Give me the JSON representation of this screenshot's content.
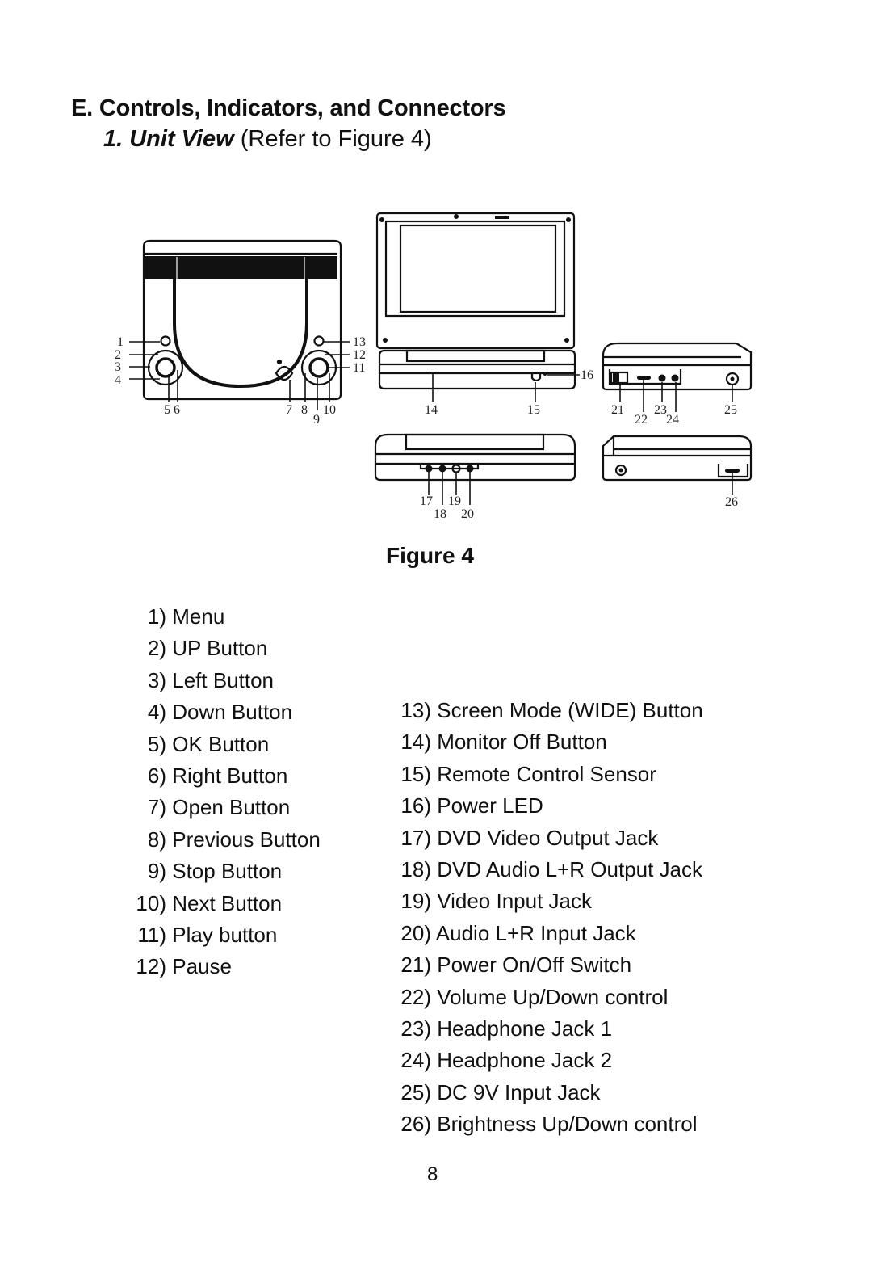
{
  "heading": "E. Controls, Indicators, and Connectors",
  "subheading": {
    "label": "1. Unit View",
    "ref": "(Refer to Figure 4)"
  },
  "figure": {
    "caption": "Figure 4",
    "callouts": {
      "top_view": [
        "1",
        "2",
        "3",
        "4",
        "5",
        "6",
        "7",
        "8",
        "9",
        "10",
        "11",
        "12",
        "13"
      ],
      "front_view": [
        "14",
        "15",
        "16"
      ],
      "right_view": [
        "21",
        "22",
        "23",
        "24",
        "25"
      ],
      "rear_view": [
        "17",
        "18",
        "19",
        "20"
      ],
      "left_view": [
        "26"
      ]
    }
  },
  "items_left": [
    {
      "num": "1)",
      "label": "Menu"
    },
    {
      "num": "2)",
      "label": "UP Button"
    },
    {
      "num": "3)",
      "label": "Left Button"
    },
    {
      "num": "4)",
      "label": "Down Button"
    },
    {
      "num": "5)",
      "label": "OK Button"
    },
    {
      "num": "6)",
      "label": "Right Button"
    },
    {
      "num": "7)",
      "label": "Open Button"
    },
    {
      "num": "8)",
      "label": "Previous Button"
    },
    {
      "num": "9)",
      "label": "Stop Button"
    },
    {
      "num": "10)",
      "label": "Next Button"
    },
    {
      "num": "11)",
      "label": "Play button"
    },
    {
      "num": "12)",
      "label": "Pause"
    }
  ],
  "items_right": [
    {
      "num": "13)",
      "label": "Screen Mode (WIDE) Button"
    },
    {
      "num": "14)",
      "label": "Monitor Off Button"
    },
    {
      "num": "15)",
      "label": "Remote Control Sensor"
    },
    {
      "num": "16)",
      "label": "Power LED"
    },
    {
      "num": "17)",
      "label": "DVD Video Output Jack"
    },
    {
      "num": "18)",
      "label": "DVD Audio L+R Output Jack"
    },
    {
      "num": "19)",
      "label": "Video Input Jack"
    },
    {
      "num": "20)",
      "label": "Audio L+R Input Jack"
    },
    {
      "num": "21)",
      "label": "Power On/Off Switch"
    },
    {
      "num": "22)",
      "label": "Volume Up/Down control"
    },
    {
      "num": "23)",
      "label": "Headphone Jack 1"
    },
    {
      "num": "24)",
      "label": "Headphone Jack 2"
    },
    {
      "num": "25)",
      "label": "DC 9V Input Jack"
    },
    {
      "num": "26)",
      "label": "Brightness Up/Down control"
    }
  ],
  "page_number": "8"
}
